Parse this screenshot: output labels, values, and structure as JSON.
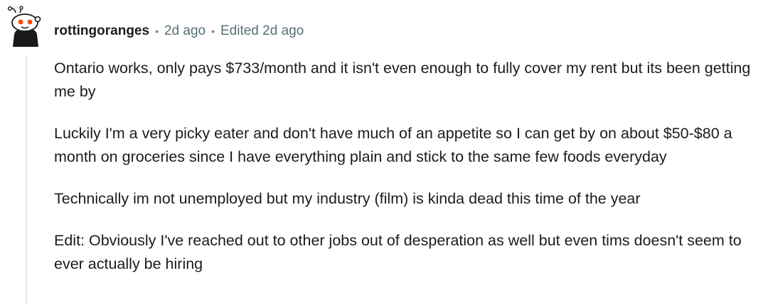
{
  "comment": {
    "username": "rottingoranges",
    "separator": "•",
    "posted": "2d ago",
    "edited": "Edited 2d ago",
    "paragraphs": [
      "Ontario works, only pays $733/month and it isn't even enough to fully cover my rent but its been getting me by",
      "Luckily I'm a very picky eater and don't have much of an appetite so I can get by on about $50-$80 a month on groceries since I have everything plain and stick to the same few foods everyday",
      "Technically im not unemployed but my industry (film) is kinda dead this time of the year",
      "Edit: Obviously I've reached out to other jobs out of desperation as well but even tims doesn't seem to ever actually be hiring"
    ]
  },
  "avatar": {
    "icon": "reddit-snoo-avatar-icon",
    "colors": {
      "body": "#1a1a1b",
      "head": "#ffffff",
      "eyes": "#ff4500"
    }
  },
  "colors": {
    "text": "#1c1c1c",
    "meta": "#576f76",
    "thread_line": "#e5e5e5"
  }
}
